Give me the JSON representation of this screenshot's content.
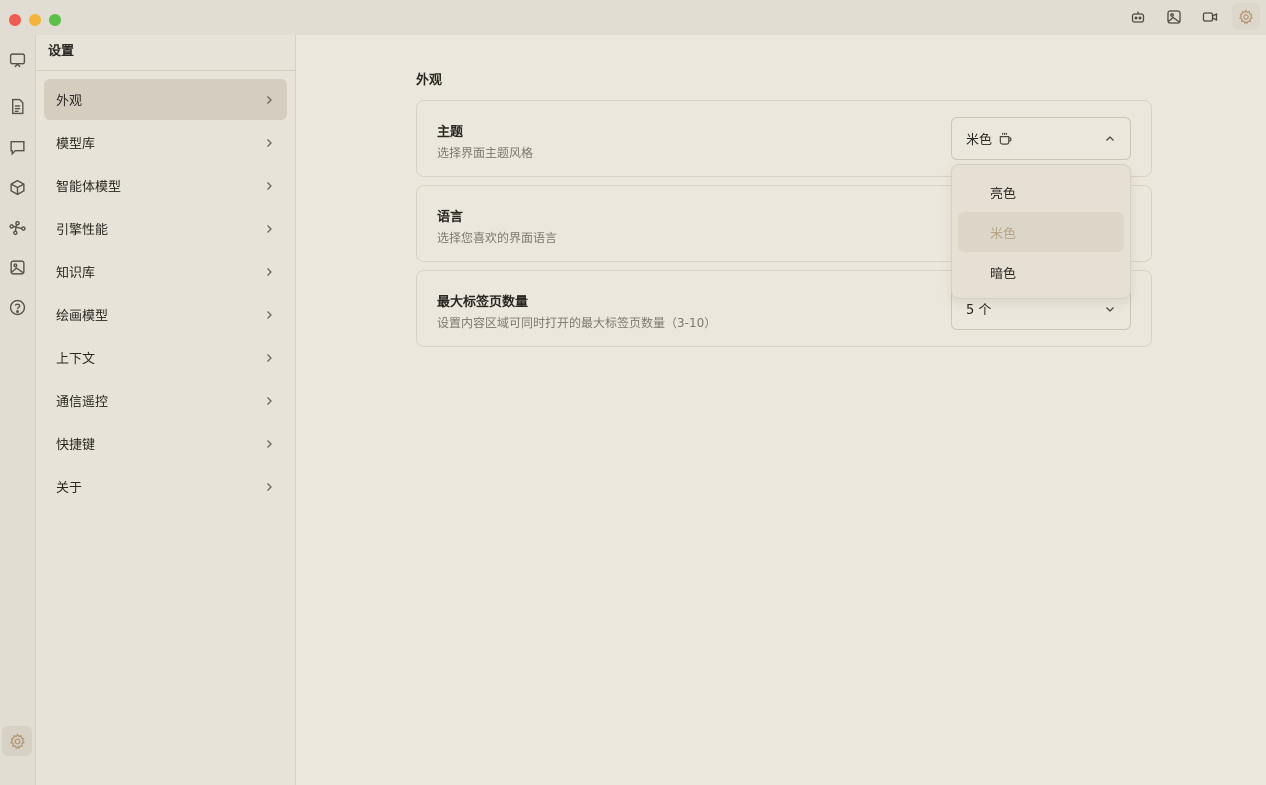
{
  "window": {
    "top_icons": [
      "robot-icon",
      "image-icon",
      "video-icon",
      "gear-icon"
    ]
  },
  "rail": {
    "icons": [
      "presentation-icon",
      "document-icon",
      "chat-icon",
      "cube-icon",
      "workflow-icon",
      "image-icon",
      "help-icon"
    ],
    "bottom_icon": "gear-icon"
  },
  "sidebar": {
    "title": "设置",
    "items": [
      {
        "label": "外观"
      },
      {
        "label": "模型库"
      },
      {
        "label": "智能体模型"
      },
      {
        "label": "引擎性能"
      },
      {
        "label": "知识库"
      },
      {
        "label": "绘画模型"
      },
      {
        "label": "上下文"
      },
      {
        "label": "通信遥控"
      },
      {
        "label": "快捷键"
      },
      {
        "label": "关于"
      }
    ]
  },
  "main": {
    "section_title": "外观",
    "theme": {
      "title": "主题",
      "desc": "选择界面主题风格",
      "value": "米色",
      "options": [
        "亮色",
        "米色",
        "暗色"
      ]
    },
    "language": {
      "title": "语言",
      "desc": "选择您喜欢的界面语言"
    },
    "max_tabs": {
      "title": "最大标签页数量",
      "desc": "设置内容区域可同时打开的最大标签页数量（3-10）",
      "value": "5 个"
    }
  },
  "colors": {
    "accent": "#b49a78",
    "background": "#ece7dc"
  }
}
